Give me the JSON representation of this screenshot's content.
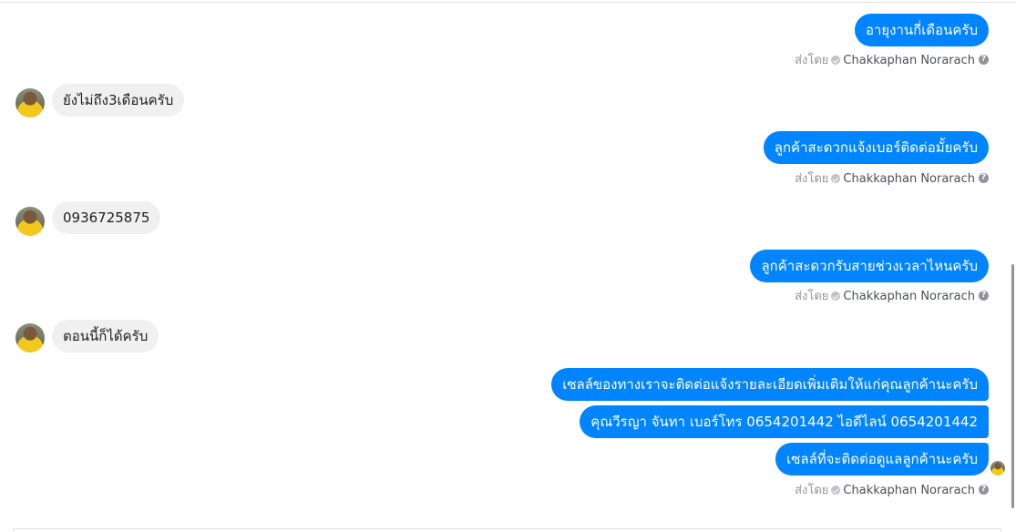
{
  "messages": {
    "m1": "อายุงานกี่เดือนครับ",
    "m2": "ยังไม่ถึง3เดือนครับ",
    "m3": "ลูกค้าสะดวกแจ้งเบอร์ติดต่อมั้ยครับ",
    "m4": "0936725875",
    "m5": "ลูกค้าสะดวกรับสายช่วงเวลาไหนครับ",
    "m6": "ตอนนี้ก็ได้ครับ",
    "m7": "เซลล์ของทางเราจะติดต่อแจ้งรายละเอียดเพิ่มเติมให้แก่คุณลูกค้านะครับ",
    "m8": "คุณวีรญา จันทา      เบอร์โทร 0654201442  ไอดีไลน์ 0654201442",
    "m9": "เซลล์ที่จะติดต่อดูแลลูกค้านะครับ"
  },
  "sent_by": {
    "prefix": "ส่งโดย",
    "name": "Chakkaphan Norarach",
    "help": "?"
  },
  "colors": {
    "outgoing": "#0084ff",
    "incoming": "#f1f0f0"
  },
  "icons": [
    "verified-check-icon",
    "help-icon",
    "avatar"
  ]
}
